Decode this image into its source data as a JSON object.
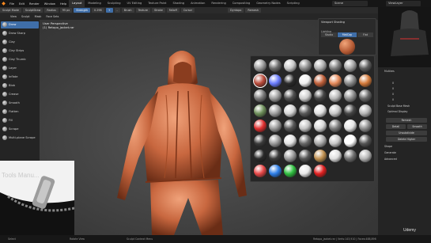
{
  "menubar": {
    "logo": "◆",
    "menu": [
      "File",
      "Edit",
      "Render",
      "Window",
      "Help"
    ],
    "workspaces": [
      "Layout",
      "Modeling",
      "Sculpting",
      "UV Editing",
      "Texture Paint",
      "Shading",
      "Animation",
      "Rendering",
      "Compositing",
      "Geometry Nodes",
      "Scripting"
    ],
    "active_workspace": "Layout",
    "scene": "Scene",
    "view_layer": "ViewLayer"
  },
  "header": {
    "mode": "Sculpt Mode",
    "brush": "SculptDraw",
    "radius": "Radius",
    "radius_value": "95 px",
    "strength": "Strength",
    "strength_value": "0.298",
    "direction": "+",
    "direction2": "-",
    "brush_menu": "Brush",
    "texture_menu": "Texture",
    "stroke_menu": "Stroke",
    "falloff_menu": "Falloff",
    "cursor_menu": "Cursor",
    "dyntopo": "Dyntopo",
    "remesh": "Remesh",
    "face_sets": "Face Sets",
    "view": "View",
    "sculpt": "Sculpt",
    "mask": "Mask",
    "face_sets_menu": "Face Sets"
  },
  "tools": [
    "Draw",
    "Draw Sharp",
    "Clay",
    "Clay Strips",
    "Clay Thumb",
    "Layer",
    "Inflate",
    "Blob",
    "Crease",
    "Smooth",
    "Flatten",
    "Fill",
    "Scrape",
    "Multi-plane Scrape"
  ],
  "viewport": {
    "perspective": "User Perspective",
    "object": "(1) Retopo_jacket.rar",
    "zipper_text": "Tools Manu..."
  },
  "shading_popover": {
    "title": "Viewport Shading",
    "lighting_label": "Lighting",
    "modes": [
      "Studio",
      "MatCap",
      "Flat"
    ],
    "active_mode": "MatCap"
  },
  "matcaps": {
    "count": 40,
    "selected_index": 8,
    "colors": [
      [
        "#9a9a9a",
        "#6b6b6b",
        "#c9c9c9",
        "#8b8b8b",
        "#b0b0b0",
        "#7d7d7d",
        "#a5a5a5",
        "#5e5e5e"
      ],
      [
        "#b84a3a",
        "#6a7cff",
        "#2a2a2a",
        "#f0f0f0",
        "#c0603a",
        "#e58a5a",
        "#8a8a8a",
        "#d47a3a"
      ],
      [
        "#7a7a7a",
        "#9e9e9e",
        "#505050",
        "#cfcfcf",
        "#444444",
        "#b9b9b9",
        "#8e8e8e",
        "#666666"
      ],
      [
        "#6e8f5a",
        "#a0a0a0",
        "#d6d6d6",
        "#5a5a5a",
        "#e0e0e0",
        "#c8c8c8",
        "#444444",
        "#b5b5b5"
      ],
      [
        "#e03030",
        "#9a9a9a",
        "#585858",
        "#c4c4c4",
        "#d8d8d8",
        "#7a7a7a",
        "#e6e6e6",
        "#8c8c8c"
      ],
      [
        "#3a3a3a",
        "#999999",
        "#e3e3e3",
        "#676767",
        "#aaaaaa",
        "#c8c8c8",
        "#ffffff",
        "#555555"
      ],
      [
        "#2a2a2a",
        "#3b3b3b",
        "#9b9b9b",
        "#565656",
        "#c09050",
        "#e0e0e0",
        "#707070",
        "#b7b7b7"
      ],
      [
        "#e84848",
        "#2e7fe8",
        "#30c040",
        "#e8e8e8",
        "#e02020"
      ]
    ]
  },
  "properties": {
    "buttons": [
      "Remesh",
      "Detail",
      "Smooth",
      "Unsubdivide",
      "Delete Higher",
      "Sculpt"
    ],
    "rows": [
      "Shape",
      "Generate",
      "Advanced"
    ],
    "value_rows": [
      "0",
      "0",
      "0",
      "0"
    ],
    "checkboxes": [
      "Sculpt Base Mesh",
      "Optimal Display"
    ],
    "multires": "Multires"
  },
  "statusbar": {
    "select": "Select",
    "rotate": "Rotate View",
    "menu": "Sculpt Context Menu",
    "stats": "Retopo_jacket.rar | Verts:143,910 | Faces:488,896"
  },
  "watermark": "Udemy"
}
